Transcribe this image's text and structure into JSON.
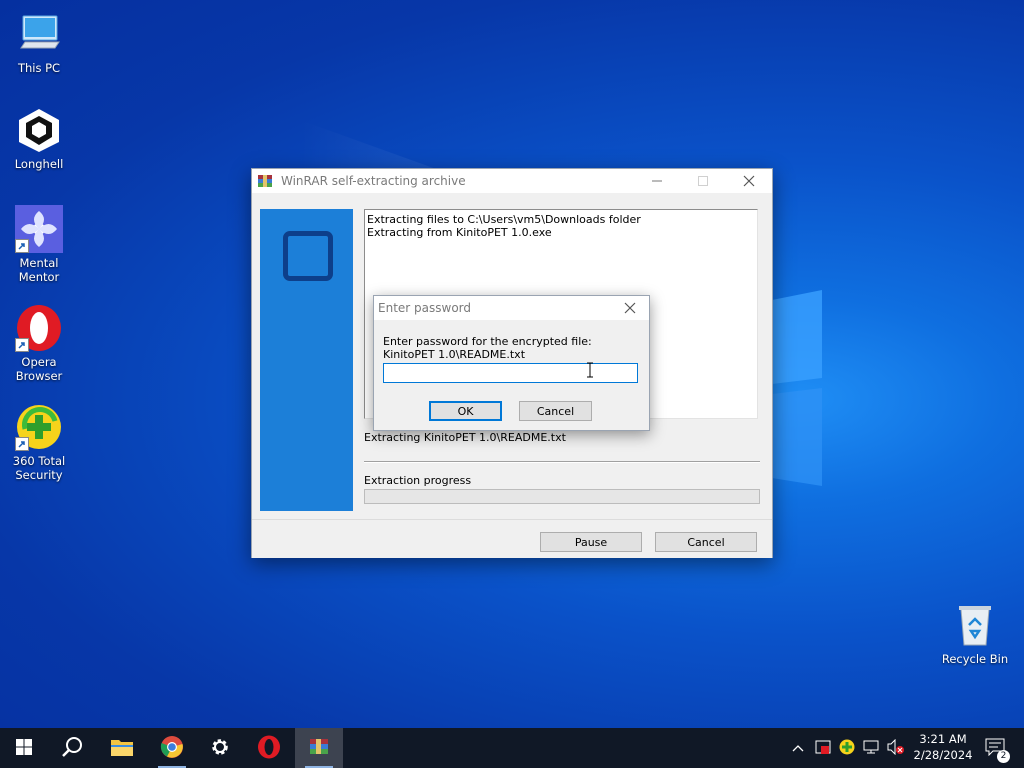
{
  "desktop": {
    "icons": [
      {
        "label": "This PC",
        "icon": "computer-icon"
      },
      {
        "label": "Longhell",
        "icon": "unity-icon"
      },
      {
        "label": "Mental Mentor",
        "icon": "mental-mentor-icon"
      },
      {
        "label": "Opera Browser",
        "icon": "opera-icon"
      },
      {
        "label": "360 Total Security",
        "icon": "360-security-icon"
      },
      {
        "label": "Recycle Bin",
        "icon": "recycle-bin-icon"
      }
    ]
  },
  "sfx": {
    "title": "WinRAR self-extracting archive",
    "log_lines": [
      "Extracting files to C:\\Users\\vm5\\Downloads folder",
      "Extracting from KinitoPET 1.0.exe"
    ],
    "status": "Extracting KinitoPET 1.0\\README.txt",
    "progress_label": "Extraction progress",
    "progress": 0,
    "pause_label": "Pause",
    "cancel_label": "Cancel"
  },
  "password_dialog": {
    "title": "Enter password",
    "prompt_line1": "Enter password for the encrypted file:",
    "prompt_line2": "KinitoPET 1.0\\README.txt",
    "input_value": "",
    "ok_label": "OK",
    "cancel_label": "Cancel"
  },
  "taskbar": {
    "items": [
      "start-icon",
      "search-icon",
      "file-explorer-icon",
      "chrome-icon",
      "settings-icon",
      "opera-icon",
      "winrar-icon"
    ],
    "active_item": "winrar-icon",
    "clock_time": "3:21 AM",
    "clock_date": "2/28/2024",
    "notification_count": "2"
  },
  "colors": {
    "accent": "#0078d7",
    "taskbar": "#101826",
    "banner": "#1c7fd8"
  }
}
